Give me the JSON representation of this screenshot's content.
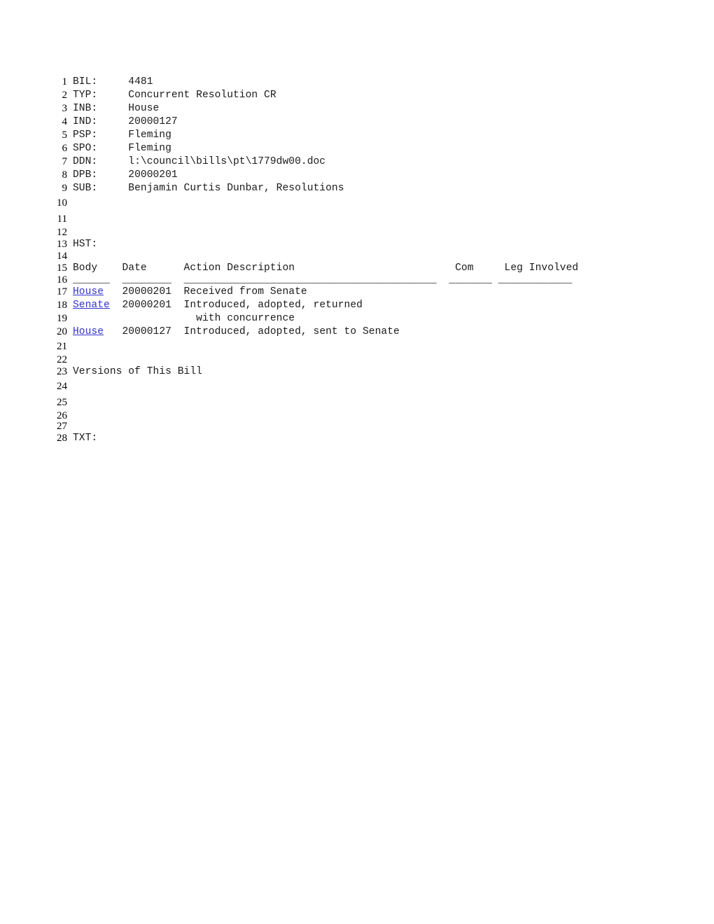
{
  "document": {
    "type": "legislative-bill-record",
    "link_color": "#3333cc",
    "text_color": "#1a1a1a",
    "background_color": "#ffffff"
  },
  "fields": [
    {
      "key": "BIL:",
      "value": "4481"
    },
    {
      "key": "TYP:",
      "value": "Concurrent Resolution CR"
    },
    {
      "key": "INB:",
      "value": "House"
    },
    {
      "key": "IND:",
      "value": "20000127"
    },
    {
      "key": "PSP:",
      "value": "Fleming"
    },
    {
      "key": "SPO:",
      "value": "Fleming"
    },
    {
      "key": "DDN:",
      "value": "l:\\council\\bills\\pt\\1779dw00.doc"
    },
    {
      "key": "DPB:",
      "value": "20000201"
    },
    {
      "key": "SUB:",
      "value": "Benjamin Curtis Dunbar, Resolutions"
    }
  ],
  "history": {
    "label": "HST:",
    "columns": {
      "body": "Body",
      "date": "Date",
      "action": "Action Description",
      "com": "Com",
      "leg": "Leg Involved"
    },
    "rules": {
      "body": "______",
      "date": "________",
      "action": "_________________________________________",
      "com": "_______",
      "leg": "____________"
    },
    "rows": [
      {
        "body": "House",
        "date": "20000201",
        "action": "Received from Senate",
        "com": "",
        "leg": ""
      },
      {
        "body": "Senate",
        "date": "20000201",
        "action": "Introduced, adopted, returned",
        "com": "",
        "leg": ""
      },
      {
        "body": "",
        "date": "",
        "action": "with concurrence",
        "com": "",
        "leg": ""
      },
      {
        "body": "House",
        "date": "20000127",
        "action": "Introduced, adopted, sent to Senate",
        "com": "",
        "leg": ""
      }
    ]
  },
  "versions_heading": "Versions of This Bill",
  "text_label": "TXT:",
  "line_numbers": [
    "1",
    "2",
    "3",
    "4",
    "5",
    "6",
    "7",
    "8",
    "9",
    "10",
    "11",
    "12",
    "13",
    "14",
    "15",
    "16",
    "17",
    "18",
    "19",
    "20",
    "21",
    "22",
    "23",
    "24",
    "25",
    "26",
    "27",
    "28"
  ],
  "lines": [
    {
      "n": "1",
      "spacing": "normal",
      "segments": [
        {
          "text": "BIL:     4481"
        }
      ]
    },
    {
      "n": "2",
      "spacing": "normal",
      "segments": [
        {
          "text": "TYP:     Concurrent Resolution CR"
        }
      ]
    },
    {
      "n": "3",
      "spacing": "normal",
      "segments": [
        {
          "text": "INB:     House"
        }
      ]
    },
    {
      "n": "4",
      "spacing": "normal",
      "segments": [
        {
          "text": "IND:     20000127"
        }
      ]
    },
    {
      "n": "5",
      "spacing": "normal",
      "segments": [
        {
          "text": "PSP:     Fleming"
        }
      ]
    },
    {
      "n": "6",
      "spacing": "normal",
      "segments": [
        {
          "text": "SPO:     Fleming"
        }
      ]
    },
    {
      "n": "7",
      "spacing": "normal",
      "segments": [
        {
          "text": "DDN:     l:\\council\\bills\\pt\\1779dw00.doc"
        }
      ]
    },
    {
      "n": "8",
      "spacing": "normal",
      "segments": [
        {
          "text": "DPB:     20000201"
        }
      ]
    },
    {
      "n": "9",
      "spacing": "normal",
      "segments": [
        {
          "text": "SUB:     Benjamin Curtis Dunbar, Resolutions"
        }
      ]
    },
    {
      "n": "10",
      "spacing": "gap",
      "segments": []
    },
    {
      "n": "11",
      "spacing": "gap",
      "segments": []
    },
    {
      "n": "12",
      "spacing": "tight",
      "segments": []
    },
    {
      "n": "13",
      "spacing": "normal",
      "segments": [
        {
          "text": "HST:"
        }
      ]
    },
    {
      "n": "14",
      "spacing": "tight",
      "segments": []
    },
    {
      "n": "15",
      "spacing": "normal",
      "segments": [
        {
          "text": "Body    Date      Action Description                          Com     Leg Involved"
        }
      ]
    },
    {
      "n": "16",
      "spacing": "tight",
      "segments": [
        {
          "text": "______  ________  _________________________________________  _______ ____________"
        }
      ]
    },
    {
      "n": "17",
      "spacing": "normal",
      "segments": [
        {
          "text": "House",
          "link": true
        },
        {
          "text": "   20000201  Received from Senate"
        }
      ]
    },
    {
      "n": "18",
      "spacing": "normal",
      "segments": [
        {
          "text": "Senate",
          "link": true
        },
        {
          "text": "  20000201  Introduced, adopted, returned"
        }
      ]
    },
    {
      "n": "19",
      "spacing": "normal",
      "segments": [
        {
          "text": "                    with concurrence"
        }
      ]
    },
    {
      "n": "20",
      "spacing": "normal",
      "segments": [
        {
          "text": "House",
          "link": true
        },
        {
          "text": "   20000127  Introduced, adopted, sent to Senate"
        }
      ]
    },
    {
      "n": "21",
      "spacing": "gap",
      "segments": []
    },
    {
      "n": "22",
      "spacing": "tight",
      "segments": []
    },
    {
      "n": "23",
      "spacing": "normal",
      "segments": [
        {
          "text": "Versions of This Bill"
        }
      ]
    },
    {
      "n": "24",
      "spacing": "gap",
      "segments": []
    },
    {
      "n": "25",
      "spacing": "gap",
      "segments": []
    },
    {
      "n": "26",
      "spacing": "tight",
      "segments": []
    },
    {
      "n": "27",
      "spacing": "tight",
      "segments": []
    },
    {
      "n": "28",
      "spacing": "normal",
      "segments": [
        {
          "text": "TXT:"
        }
      ]
    }
  ]
}
